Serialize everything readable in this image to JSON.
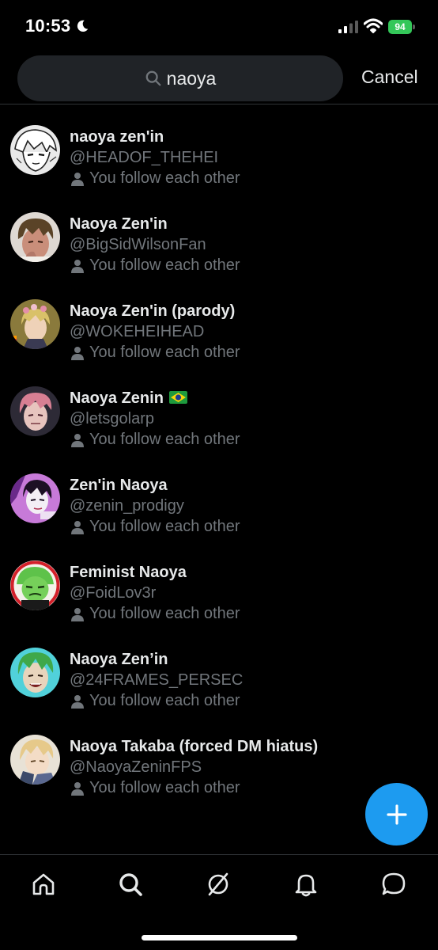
{
  "status_bar": {
    "time": "10:53",
    "battery": "94"
  },
  "search": {
    "query": "naoya",
    "cancel_label": "Cancel"
  },
  "results": [
    {
      "name": "naoya zen'in",
      "handle": "@HEADOF_THEHEI",
      "follow_status": "You follow each other",
      "avatar": "manga-sketch"
    },
    {
      "name": "Naoya Zen'in",
      "handle": "@BigSidWilsonFan",
      "follow_status": "You follow each other",
      "avatar": "brown-hair"
    },
    {
      "name": "Naoya Zen'in (parody)",
      "handle": "@WOKEHEIHEAD",
      "follow_status": "You follow each other",
      "avatar": "flower-crown"
    },
    {
      "name": "Naoya Zenin",
      "handle": "@letsgolarp",
      "follow_status": "You follow each other",
      "avatar": "pink-hair"
    },
    {
      "name": "Zen'in Naoya",
      "handle": "@zenin_prodigy",
      "follow_status": "You follow each other",
      "avatar": "purple-art"
    },
    {
      "name": "Feminist Naoya",
      "handle": "@FoidLov3r",
      "follow_status": "You follow each other",
      "avatar": "green-mask"
    },
    {
      "name": "Naoya Zen’in",
      "handle": "@24FRAMES_PERSEC",
      "follow_status": "You follow each other",
      "avatar": "green-hair"
    },
    {
      "name": "Naoya Takaba (forced DM hiatus)",
      "handle": "@NaoyaZeninFPS",
      "follow_status": "You follow each other",
      "avatar": "blonde-hair"
    }
  ],
  "colors": {
    "background": "#000000",
    "primary_text": "#e7e9ea",
    "secondary_text": "#71767b",
    "accent": "#1d9bf0",
    "search_field": "#202327",
    "battery": "#34c759"
  },
  "icons": {
    "fab": "plus-icon",
    "nav": [
      "home-icon",
      "search-icon",
      "spaces-icon",
      "notifications-icon",
      "messages-icon"
    ]
  }
}
